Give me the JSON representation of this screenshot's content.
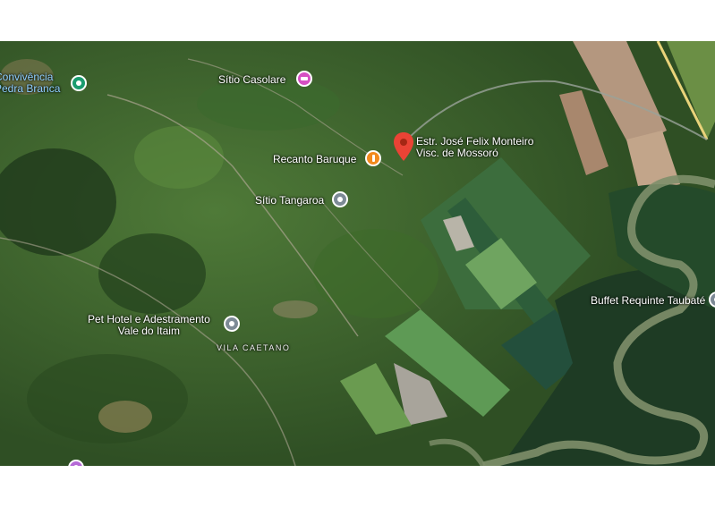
{
  "map": {
    "places": [
      {
        "id": "convivencia",
        "line1": "Convivência",
        "line2": "Pedra Branca",
        "icon": "park-icon",
        "color": "#1a9c6f"
      },
      {
        "id": "casolare",
        "name": "Sítio Casolare",
        "icon": "hotel-icon",
        "color": "#d64fc3"
      },
      {
        "id": "baruque",
        "name": "Recanto Baruque",
        "icon": "restaurant-icon",
        "color": "#f28a1e"
      },
      {
        "id": "tangaroa",
        "name": "Sítio Tangaroa",
        "icon": "place-icon",
        "color": "#7d8a96"
      },
      {
        "id": "pethotel",
        "line1": "Pet Hotel e Adestramento",
        "line2": "Vale do Itaim",
        "icon": "place-icon",
        "color": "#7d8a96"
      },
      {
        "id": "buffet",
        "name": "Buffet Requinte Taubaté",
        "icon": "place-icon",
        "color": "#7d8a96"
      },
      {
        "id": "bottom",
        "icon": "place-icon",
        "color": "#b56ad6"
      }
    ],
    "selected_pin": {
      "line1": "Estr. José Felix Monteiro",
      "line2": "Visc. de Mossoró",
      "icon": "red-map-pin-icon",
      "color": "#ea4335"
    },
    "area_label": "VILA CAETANO"
  }
}
